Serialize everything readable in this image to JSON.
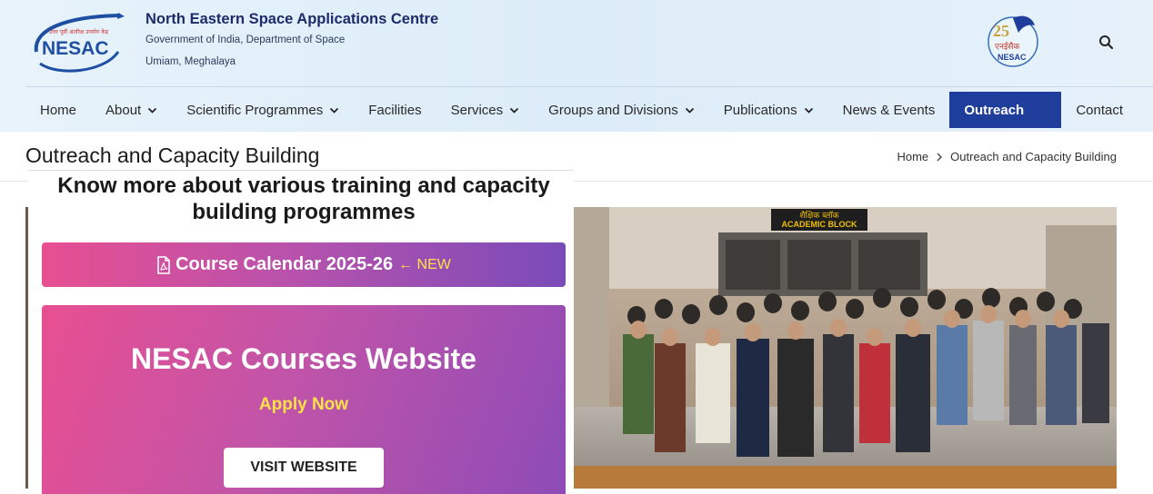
{
  "header": {
    "logo_text": "NESAC",
    "logo_hindi": "उत्तर पूर्वी अंतरिक्ष उपयोग केंद्र",
    "org_name": "North Eastern Space Applications Centre",
    "org_sub1": "Government of India, Department of Space",
    "org_sub2": "Umiam, Meghalaya",
    "emblem_text": "NESAC",
    "emblem_hindi": "एनईसैक"
  },
  "nav": {
    "items": [
      {
        "label": "Home",
        "dropdown": false
      },
      {
        "label": "About",
        "dropdown": true
      },
      {
        "label": "Scientific Programmes",
        "dropdown": true
      },
      {
        "label": "Facilities",
        "dropdown": false
      },
      {
        "label": "Services",
        "dropdown": true
      },
      {
        "label": "Groups and Divisions",
        "dropdown": true
      },
      {
        "label": "Publications",
        "dropdown": true
      },
      {
        "label": "News & Events",
        "dropdown": false
      },
      {
        "label": "Outreach",
        "dropdown": false,
        "active": true
      },
      {
        "label": "Contact",
        "dropdown": false
      }
    ]
  },
  "page": {
    "title": "Outreach and Capacity Building",
    "breadcrumb": {
      "home": "Home",
      "current": "Outreach and Capacity Building"
    }
  },
  "photo": {
    "sign_hindi": "शैक्षिक ब्लॉक",
    "sign_english": "ACADEMIC BLOCK"
  },
  "popup": {
    "heading": "Know more about various training and capacity building programmes",
    "calendar_label": "Course Calendar 2025-26",
    "calendar_new": "← NEW",
    "courses_title": "NESAC Courses Website",
    "apply_text": "Apply Now",
    "visit_label": "VISIT WEBSITE"
  },
  "colors": {
    "nav_active": "#1f3e9c",
    "gradient_start": "#e84f91",
    "gradient_end": "#7a4bb8",
    "highlight": "#ffe14a"
  }
}
